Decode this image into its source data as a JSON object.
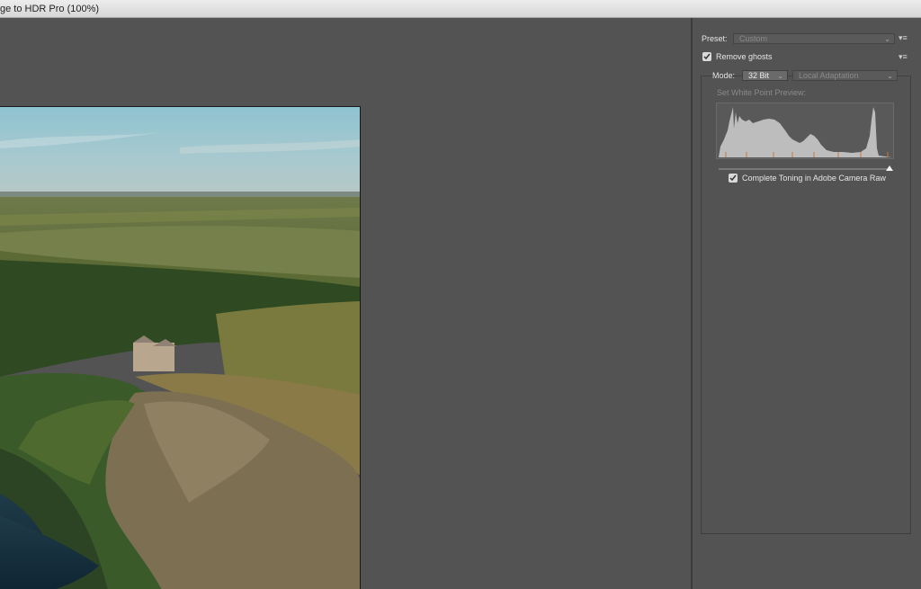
{
  "window": {
    "title": "ge to HDR Pro (100%)"
  },
  "panel": {
    "preset_label": "Preset:",
    "preset_value": "Custom",
    "remove_ghosts_label": "Remove ghosts",
    "remove_ghosts_checked": true,
    "mode_label": "Mode:",
    "mode_value": "32 Bit",
    "method_value": "Local Adaptation",
    "white_point_label": "Set White Point Preview:",
    "white_point_level": 1.0,
    "complete_toning_label": "Complete Toning in Adobe Camera Raw",
    "complete_toning_checked": true
  },
  "icons": {
    "preset_menu": "flyout-menu-icon",
    "ghosts_menu": "flyout-menu-icon",
    "dropdown": "chevron-down-icon",
    "check": "checkmark-icon"
  },
  "colors": {
    "background": "#4f4f4f",
    "panel": "#535353",
    "histogram_fill": "#bdbdbd",
    "histogram_tick": "#c9773c"
  }
}
